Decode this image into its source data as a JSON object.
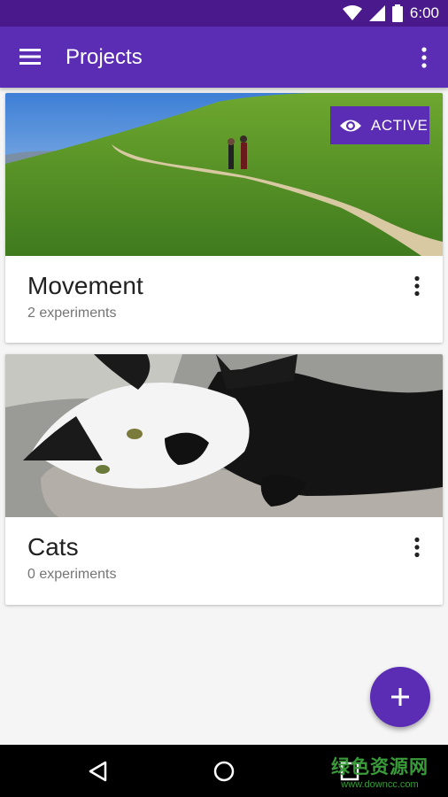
{
  "status_bar": {
    "time": "6:00"
  },
  "app_bar": {
    "title": "Projects"
  },
  "projects": [
    {
      "title": "Movement",
      "subtitle": "2 experiments",
      "badge": "ACTIVE"
    },
    {
      "title": "Cats",
      "subtitle": "0 experiments"
    }
  ],
  "icons": {
    "menu": "hamburger-menu-icon",
    "overflow": "more-vertical-icon",
    "active": "eye-icon",
    "fab": "plus-icon",
    "nav_back": "back-triangle-icon",
    "nav_home": "home-circle-icon",
    "nav_recents": "recents-square-icon"
  },
  "watermark": {
    "text": "绿色资源网",
    "url": "www.downcc.com"
  },
  "colors": {
    "primary": "#5b2db5",
    "status_bar": "#4a1a8c",
    "background": "#f5f5f5"
  }
}
